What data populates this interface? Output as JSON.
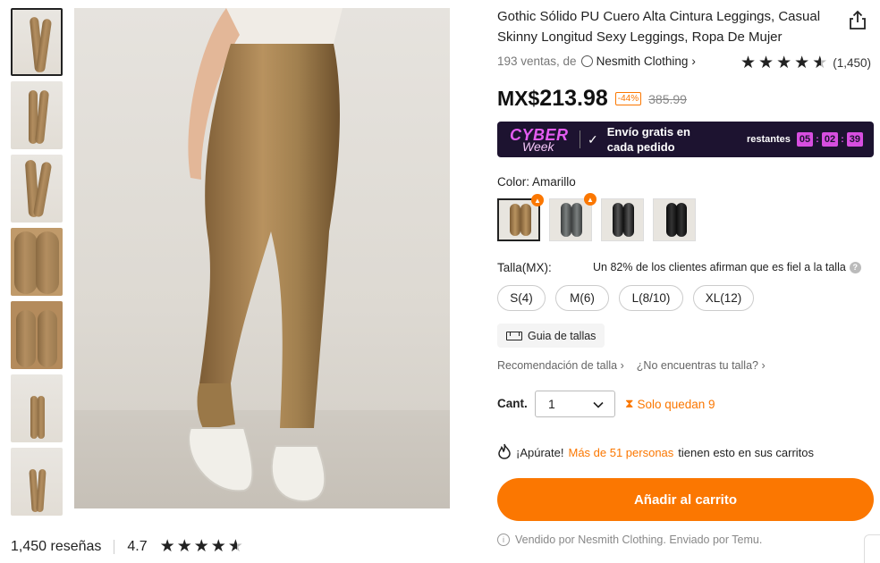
{
  "product": {
    "title": "Gothic Sólido PU Cuero Alta Cintura Leggings, Casual Skinny Longitud Sexy Leggings, Ropa De Mujer",
    "sales_text": "193 ventas, de",
    "store_name": "Nesmith Clothing",
    "rating_count": "(1,450)",
    "price_currency": "MX$",
    "price": "213.98",
    "discount": "-44%",
    "old_price": "385.99"
  },
  "promo": {
    "logo_line1": "CYBER",
    "logo_line2": "Week",
    "text": "Envío gratis en cada pedido",
    "timer_label": "restantes",
    "hours": "05",
    "minutes": "02",
    "seconds": "39",
    "colors": {
      "bg": "#1d1330",
      "accent": "#d74ee0"
    }
  },
  "color": {
    "label": "Color: Amarillo",
    "swatches": [
      {
        "name": "amarillo",
        "hot": true,
        "hot_icon": "fire-icon"
      },
      {
        "name": "gris",
        "hot": true,
        "hot_icon": "fire-icon"
      },
      {
        "name": "negro-brillante",
        "hot": false
      },
      {
        "name": "negro",
        "hot": false
      }
    ]
  },
  "size": {
    "label": "Talla(MX):",
    "fit_note": "Un 82% de los clientes afirman que es fiel a la talla",
    "options": [
      "S(4)",
      "M(6)",
      "L(8/10)",
      "XL(12)"
    ],
    "guide": "Guia de tallas",
    "rec1": "Recomendación de talla",
    "rec2": "¿No encuentras tu talla?"
  },
  "quantity": {
    "label": "Cant.",
    "value": "1",
    "stock": "Solo quedan 9"
  },
  "hurry": {
    "prefix": "¡Apúrate!",
    "highlight": "Más de 51 personas",
    "suffix": "tienen esto en sus carritos"
  },
  "cart": {
    "label": "Añadir al carrito"
  },
  "sold_by": "Vendido por Nesmith Clothing. Enviado por Temu.",
  "reviews": {
    "count_label": "1,450 reseñas",
    "score": "4.7"
  },
  "colors": {
    "accent": "#fb7701",
    "text": "#222222"
  }
}
